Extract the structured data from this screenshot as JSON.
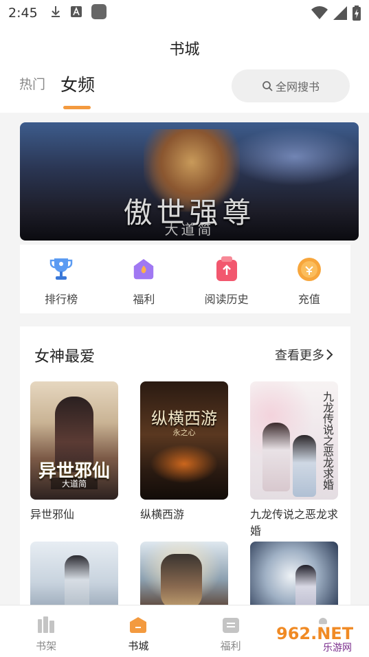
{
  "status_bar": {
    "time": "2:45"
  },
  "header": {
    "title": "书城",
    "tabs": [
      {
        "label": "热门",
        "active": false
      },
      {
        "label": "女频",
        "active": true
      }
    ],
    "search_label": "全网搜书"
  },
  "banner": {
    "title": "傲世强尊",
    "subtitle": "大道简"
  },
  "quick_links": [
    {
      "label": "排行榜",
      "icon": "trophy-icon",
      "color": "#4a8ef0"
    },
    {
      "label": "福利",
      "icon": "gift-icon",
      "color": "#9b6cf0"
    },
    {
      "label": "阅读历史",
      "icon": "history-icon",
      "color": "#f0506a"
    },
    {
      "label": "充值",
      "icon": "coin-icon",
      "color": "#f5a03c"
    }
  ],
  "section": {
    "title": "女神最爱",
    "more_label": "查看更多",
    "books": [
      {
        "title": "异世邪仙",
        "cover_title": "异世邪仙",
        "cover_author": "大道简"
      },
      {
        "title": "纵横西游",
        "cover_title": "纵横西游",
        "cover_author": "永之心"
      },
      {
        "title": "九龙传说之恶龙求婚",
        "cover_title": "九龙传说之恶龙求婚",
        "cover_author": ""
      }
    ]
  },
  "bottom_nav": [
    {
      "label": "书架",
      "active": false
    },
    {
      "label": "书城",
      "active": true
    },
    {
      "label": "福利",
      "active": false
    }
  ],
  "watermark": {
    "brand": "962.NET",
    "site": "乐游网"
  },
  "colors": {
    "accent": "#f39a3f"
  }
}
